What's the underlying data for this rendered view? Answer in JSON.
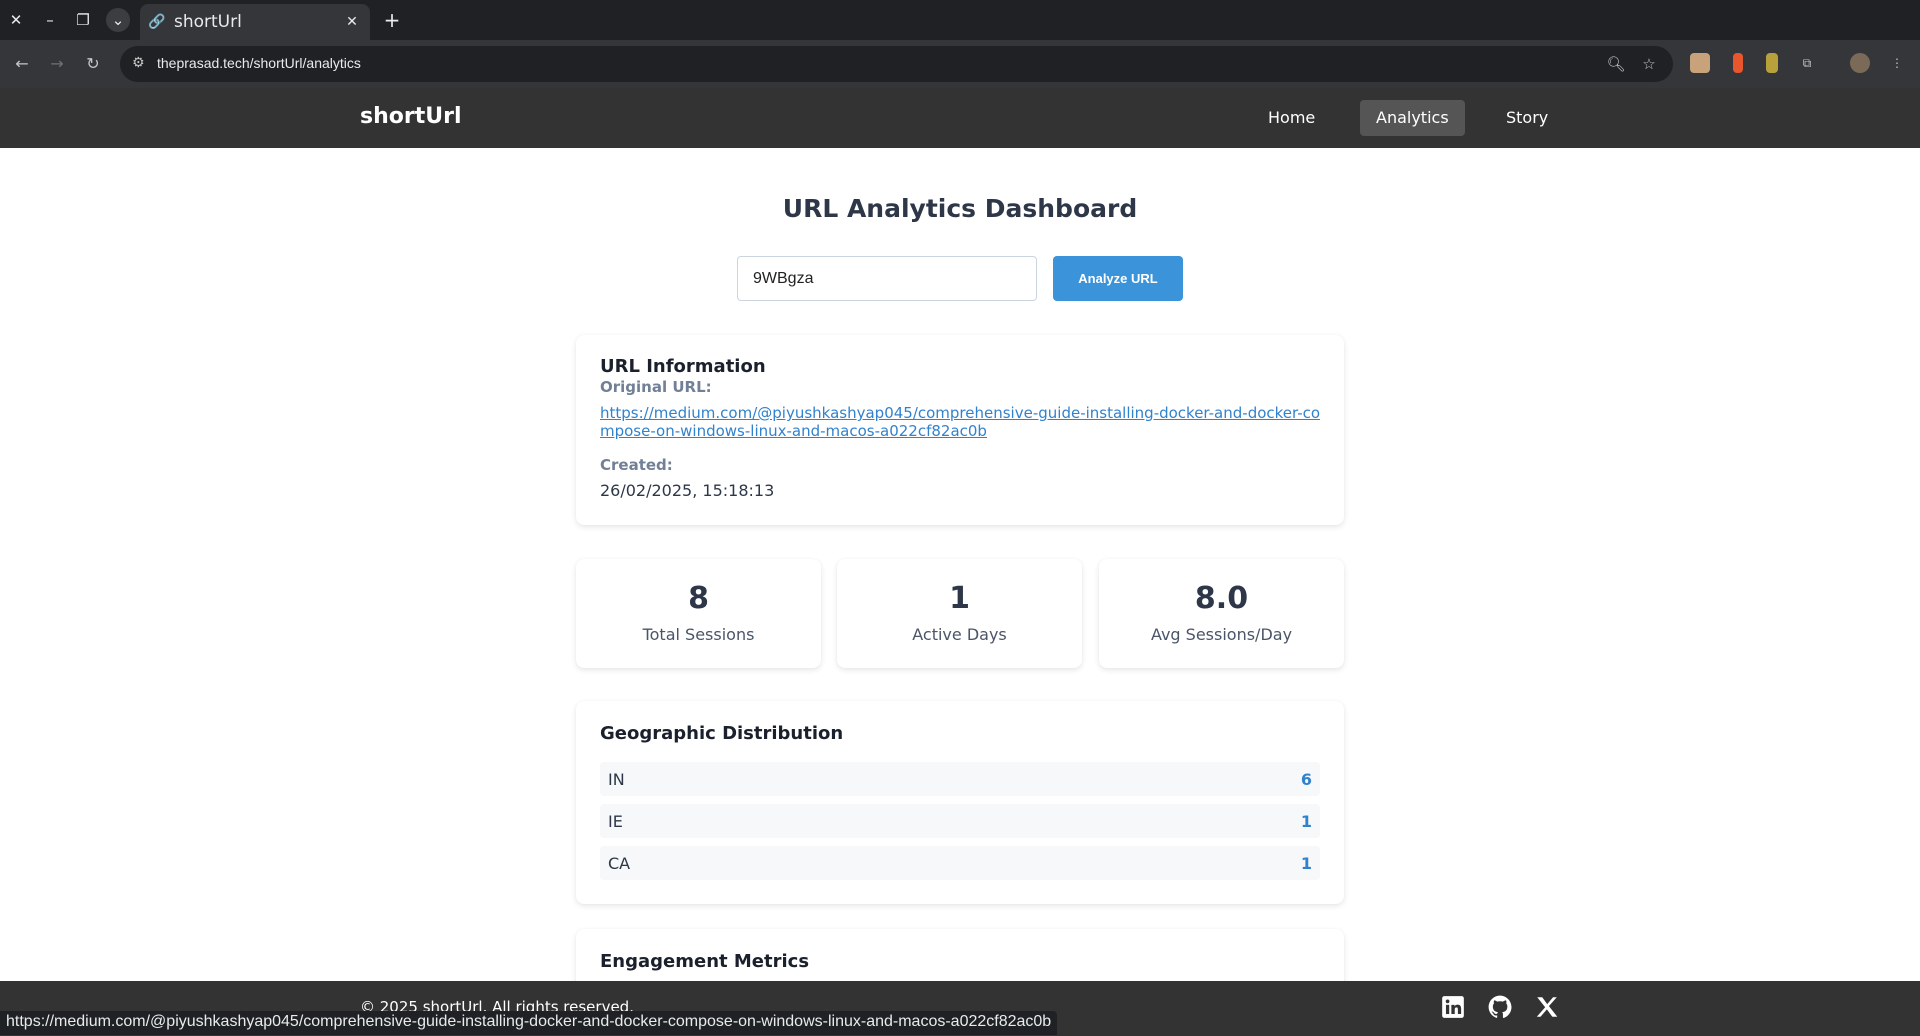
{
  "browser": {
    "tab_title": "shortUrl",
    "url": "theprasad.tech/shortUrl/analytics",
    "status_url": "https://medium.com/@piyushkashyap045/comprehensive-guide-installing-docker-and-docker-compose-on-windows-linux-and-macos-a022cf82ac0b",
    "icons": [
      "close-window-icon",
      "minimize-icon",
      "restore-icon",
      "tab-search-icon",
      "link-icon",
      "new-tab-icon",
      "back-icon",
      "forward-icon",
      "reload-icon",
      "site-info-icon",
      "zoom-icon",
      "bookmark-star-icon",
      "extensions-icon",
      "profile-icon",
      "menu-icon"
    ]
  },
  "header": {
    "brand": "shortUrl",
    "nav": [
      {
        "label": "Home"
      },
      {
        "label": "Analytics",
        "active": true
      },
      {
        "label": "Story"
      }
    ]
  },
  "main": {
    "title": "URL Analytics Dashboard",
    "input_value": "9WBgza",
    "analyze_label": "Analyze URL",
    "url_info": {
      "heading": "URL Information",
      "original_label": "Original URL:",
      "original_url": "https://medium.com/@piyushkashyap045/comprehensive-guide-installing-docker-and-docker-compose-on-windows-linux-and-macos-a022cf82ac0b",
      "created_label": "Created:",
      "created_value": "26/02/2025, 15:18:13"
    },
    "stats": [
      {
        "value": "8",
        "label": "Total Sessions"
      },
      {
        "value": "1",
        "label": "Active Days"
      },
      {
        "value": "8.0",
        "label": "Avg Sessions/Day"
      }
    ],
    "geo": {
      "heading": "Geographic Distribution",
      "rows": [
        {
          "country": "IN",
          "count": "6"
        },
        {
          "country": "IE",
          "count": "1"
        },
        {
          "country": "CA",
          "count": "1"
        }
      ]
    },
    "engagement": {
      "heading": "Engagement Metrics"
    }
  },
  "footer": {
    "copyright": "© 2025 shortUrl. All rights reserved.",
    "social": [
      "linkedin-icon",
      "github-icon",
      "x-icon"
    ]
  },
  "colors": {
    "accent": "#3b93d9",
    "link": "#3182ce",
    "header_bg": "#333333",
    "nav_active_bg": "#555555"
  }
}
